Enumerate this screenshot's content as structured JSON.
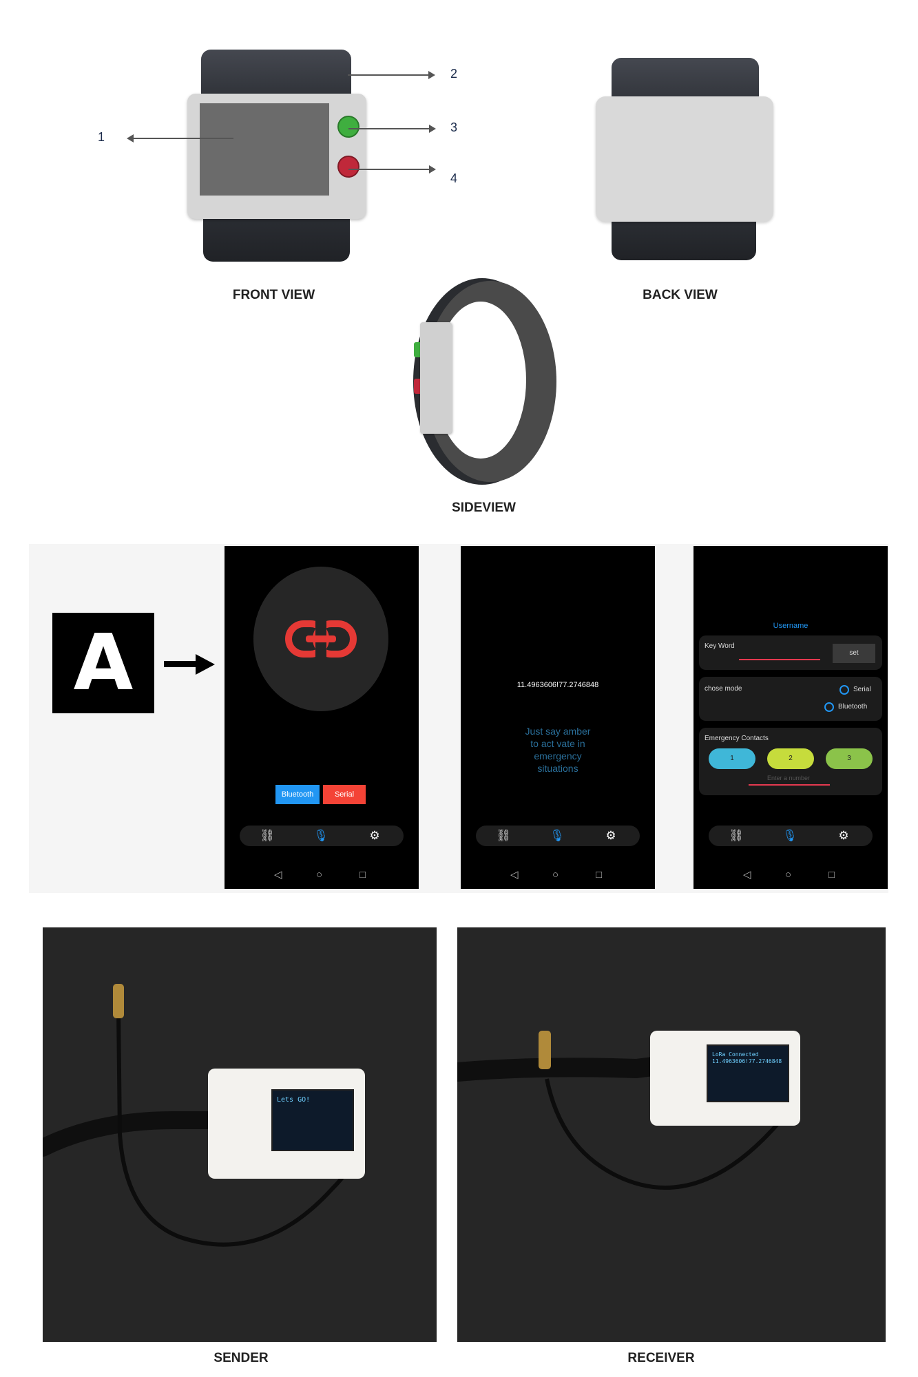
{
  "front_view": {
    "caption": "FRONT VIEW",
    "callouts": [
      "1",
      "2",
      "3",
      "4"
    ],
    "colors": {
      "band": "#3b3e45",
      "case": "#d6d6d6",
      "screen": "#6b6b6b",
      "button_top": "#3fae3f",
      "button_bottom": "#c0283a"
    }
  },
  "back_view": {
    "caption": "BACK VIEW"
  },
  "side_view": {
    "caption": "SIDEVIEW"
  },
  "app_panel": {
    "marker": "A",
    "screen1": {
      "link_icon": "link-icon",
      "bluetooth_button": "Bluetooth",
      "serial_button": "Serial",
      "colors": {
        "bluetooth": "#2196f3",
        "serial": "#f44336",
        "link": "#e53935"
      }
    },
    "screen2": {
      "coordinates": "11.4963606!77.2746848",
      "hint": "Just say amber\nto act vate in\nemergency\nsituations"
    },
    "screen3": {
      "username": "Username",
      "keyword_label": "Key Word",
      "set_button": "set",
      "mode_label": "chose mode",
      "mode_options": [
        "Serial",
        "Bluetooth"
      ],
      "contacts_label": "Emergency Contacts",
      "contacts": [
        "1",
        "2",
        "3"
      ],
      "number_placeholder": "Enter a number",
      "colors": {
        "contact1": "#3fb7d8",
        "contact2": "#c6dc3c",
        "contact3": "#8bc34a"
      }
    },
    "nav_icons": [
      "link-icon",
      "microphone-icon",
      "gear-icon"
    ],
    "system_nav": [
      "◁",
      "○",
      "□"
    ]
  },
  "devices": {
    "sender": {
      "caption": "SENDER",
      "oled_text": "Lets GO!"
    },
    "receiver": {
      "caption": "RECEIVER",
      "oled_text": "LoRa Connected\n11.4963606!77.2746848"
    }
  }
}
